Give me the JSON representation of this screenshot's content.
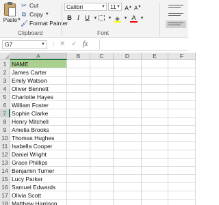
{
  "ribbon": {
    "clipboard": {
      "paste_label": "Paste",
      "cut_label": "Cut",
      "copy_label": "Copy",
      "format_painter_label": "Format Painter",
      "group_label": "Clipboard"
    },
    "font": {
      "font_name": "Calibri",
      "font_size": "11",
      "grow_label": "A",
      "shrink_label": "A",
      "bold_label": "B",
      "italic_label": "I",
      "underline_label": "U",
      "font_color_label": "A",
      "group_label": "Font",
      "highlight_color": "#ffff00",
      "font_color": "#ff0000"
    }
  },
  "formula_bar": {
    "name_box": "G7",
    "fx_label": "fx",
    "formula": ""
  },
  "grid": {
    "columns": [
      "A",
      "B",
      "C",
      "D",
      "E",
      "F"
    ],
    "selected_column": "A",
    "selected_row": "7",
    "header_fill": "#a9d08e",
    "rows": [
      {
        "num": "1",
        "value": "NAME"
      },
      {
        "num": "2",
        "value": "James Carter"
      },
      {
        "num": "3",
        "value": "Emily Watson"
      },
      {
        "num": "4",
        "value": "Oliver Bennett"
      },
      {
        "num": "5",
        "value": "Charlotte Hayes"
      },
      {
        "num": "6",
        "value": "William Foster"
      },
      {
        "num": "7",
        "value": "Sophie Clarke"
      },
      {
        "num": "8",
        "value": "Henry Mitchell"
      },
      {
        "num": "9",
        "value": "Amelia Brooks"
      },
      {
        "num": "10",
        "value": "Thomas Hughes"
      },
      {
        "num": "11",
        "value": "Isabella Cooper"
      },
      {
        "num": "12",
        "value": "Daniel Wright"
      },
      {
        "num": "13",
        "value": "Grace Phillips"
      },
      {
        "num": "14",
        "value": "Benjamin Turner"
      },
      {
        "num": "15",
        "value": "Lucy Parker"
      },
      {
        "num": "16",
        "value": "Samuel Edwards"
      },
      {
        "num": "17",
        "value": "Olivia Scott"
      },
      {
        "num": "18",
        "value": "Matthew Harrison"
      }
    ]
  }
}
